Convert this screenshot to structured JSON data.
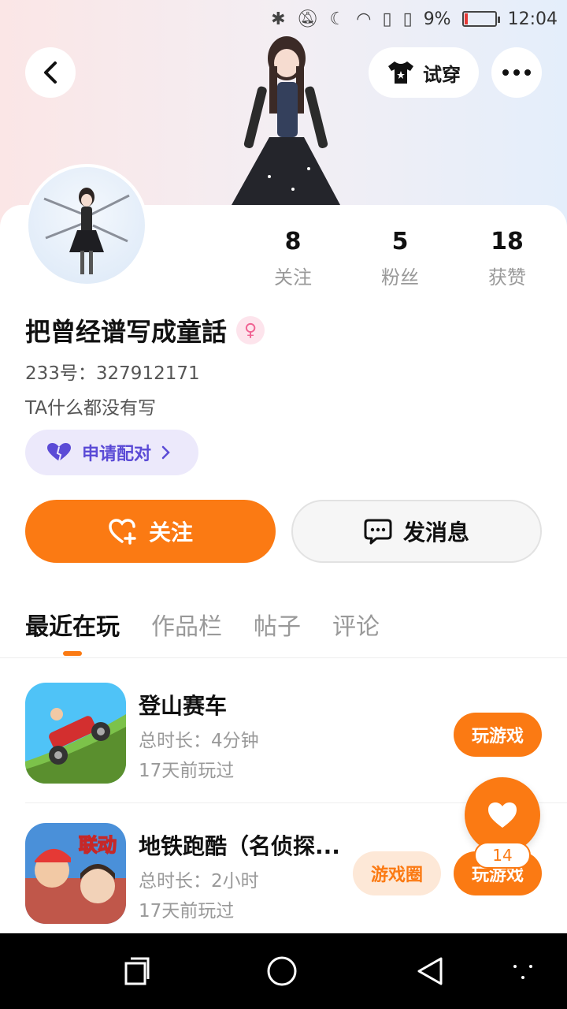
{
  "status_bar": {
    "battery": "9%",
    "time": "12:04",
    "battery_level": 0.09
  },
  "header": {
    "tryon_label": "试穿"
  },
  "stats": [
    {
      "value": "8",
      "label": "关注"
    },
    {
      "value": "5",
      "label": "粉丝"
    },
    {
      "value": "18",
      "label": "获赞"
    }
  ],
  "profile": {
    "username": "把曾经谱写成童話",
    "uid": "233号：327912171",
    "bio": "TA什么都没有写",
    "pair_label": "申请配对"
  },
  "actions": {
    "follow_label": "关注",
    "message_label": "发消息"
  },
  "tabs": [
    "最近在玩",
    "作品栏",
    "帖子",
    "评论"
  ],
  "games": [
    {
      "title": "登山赛车",
      "duration": "总时长：4分钟",
      "last_played": "17天前玩过",
      "play_label": "玩游戏"
    },
    {
      "title": "地铁跑酷（名侦探...",
      "duration": "总时长：2小时",
      "last_played": "17天前玩过",
      "play_label": "玩游戏",
      "circle_label": "游戏圈",
      "badge": "联动"
    }
  ],
  "like_fab": {
    "count": "14"
  },
  "colors": {
    "accent": "#fb7a13",
    "pair": "#5b4bd6"
  }
}
